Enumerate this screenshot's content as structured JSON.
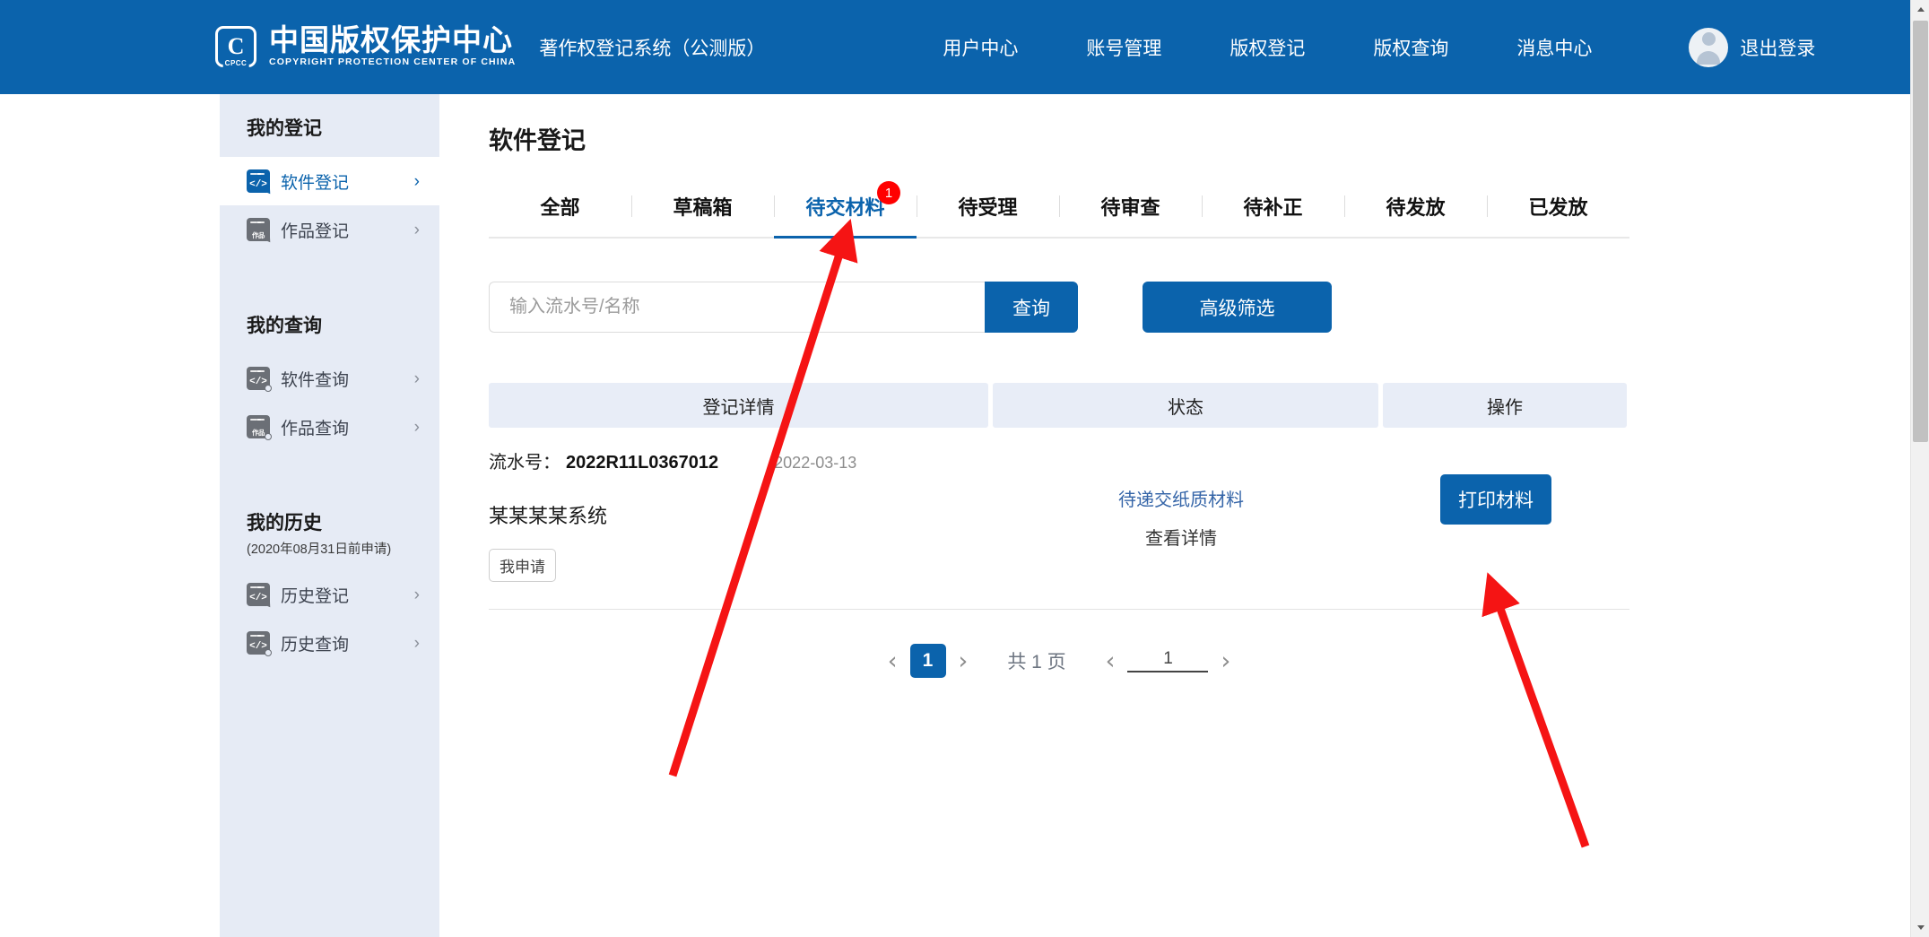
{
  "header": {
    "logo_cn": "中国版权保护中心",
    "logo_en": "COPYRIGHT PROTECTION CENTER OF CHINA",
    "logo_badge": "C",
    "logo_badge_sub": "CPCC",
    "system_title": "著作权登记系统（公测版）",
    "nav": [
      {
        "label": "用户中心"
      },
      {
        "label": "账号管理"
      },
      {
        "label": "版权登记"
      },
      {
        "label": "版权查询"
      },
      {
        "label": "消息中心"
      }
    ],
    "logout_label": "退出登录",
    "brand_color": "#0b63ac"
  },
  "sidebar": {
    "groups": [
      {
        "title": "我的登记",
        "note": "",
        "items": [
          {
            "label": "软件登记",
            "icon": "code-window-pencil-icon",
            "active": true,
            "chevron": "›"
          },
          {
            "label": "作品登记",
            "icon": "work-window-pencil-icon",
            "active": false,
            "chevron": "›"
          }
        ]
      },
      {
        "title": "我的查询",
        "note": "",
        "items": [
          {
            "label": "软件查询",
            "icon": "code-window-search-icon",
            "active": false,
            "chevron": "›"
          },
          {
            "label": "作品查询",
            "icon": "work-window-search-icon",
            "active": false,
            "chevron": "›"
          }
        ]
      },
      {
        "title": "我的历史",
        "note": "(2020年08月31日前申请)",
        "items": [
          {
            "label": "历史登记",
            "icon": "code-window-pencil-icon",
            "active": false,
            "chevron": "›"
          },
          {
            "label": "历史查询",
            "icon": "code-window-search-icon",
            "active": false,
            "chevron": "›"
          }
        ]
      }
    ]
  },
  "main": {
    "page_title": "软件登记",
    "tabs": [
      {
        "label": "全部",
        "active": false,
        "badge": ""
      },
      {
        "label": "草稿箱",
        "active": false,
        "badge": ""
      },
      {
        "label": "待交材料",
        "active": true,
        "badge": "1"
      },
      {
        "label": "待受理",
        "active": false,
        "badge": ""
      },
      {
        "label": "待审查",
        "active": false,
        "badge": ""
      },
      {
        "label": "待补正",
        "active": false,
        "badge": ""
      },
      {
        "label": "待发放",
        "active": false,
        "badge": ""
      },
      {
        "label": "已发放",
        "active": false,
        "badge": ""
      }
    ],
    "search": {
      "placeholder": "输入流水号/名称",
      "value": "",
      "search_button": "查询",
      "filter_button": "高级筛选"
    },
    "table": {
      "columns": [
        "登记详情",
        "状态",
        "操作"
      ],
      "rows": [
        {
          "serial_label": "流水号：",
          "serial": "2022R11L0367012",
          "date": "2022-03-13",
          "name": "某某某某系统",
          "tag": "我申请",
          "status": "待递交纸质材料",
          "status_link": "查看详情",
          "action": "打印材料"
        }
      ]
    },
    "pagination": {
      "prev": "‹",
      "next": "›",
      "current_page": "1",
      "total_text": "共 1 页",
      "jump_prev": "‹",
      "jump_value": "1",
      "jump_next": "›"
    }
  },
  "scrollbar": {
    "up_arrow": "up-arrow-icon",
    "down_arrow": "down-arrow-icon"
  }
}
